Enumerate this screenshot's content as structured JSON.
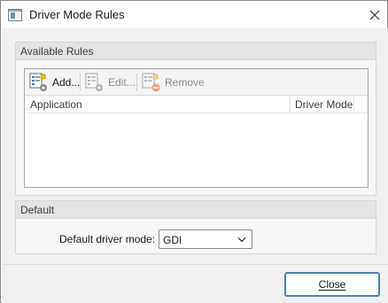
{
  "window": {
    "title": "Driver Mode Rules"
  },
  "rules_group": {
    "title": "Available Rules",
    "toolbar": {
      "add": {
        "label": "Add...",
        "icon": "add-rule-icon",
        "enabled": true
      },
      "edit": {
        "label": "Edit...",
        "icon": "edit-rule-icon",
        "enabled": false
      },
      "remove": {
        "label": "Remove",
        "icon": "remove-rule-icon",
        "enabled": false
      }
    },
    "columns": [
      "Application",
      "Driver Mode"
    ],
    "rows": []
  },
  "default_group": {
    "title": "Default",
    "mode_label": "Default driver mode:",
    "mode_value": "GDI"
  },
  "footer": {
    "close_label": "Close"
  },
  "colors": {
    "accent": "#4a7fbf",
    "group_header": "#e3e3e3",
    "disabled_text": "#8d8d8d"
  }
}
